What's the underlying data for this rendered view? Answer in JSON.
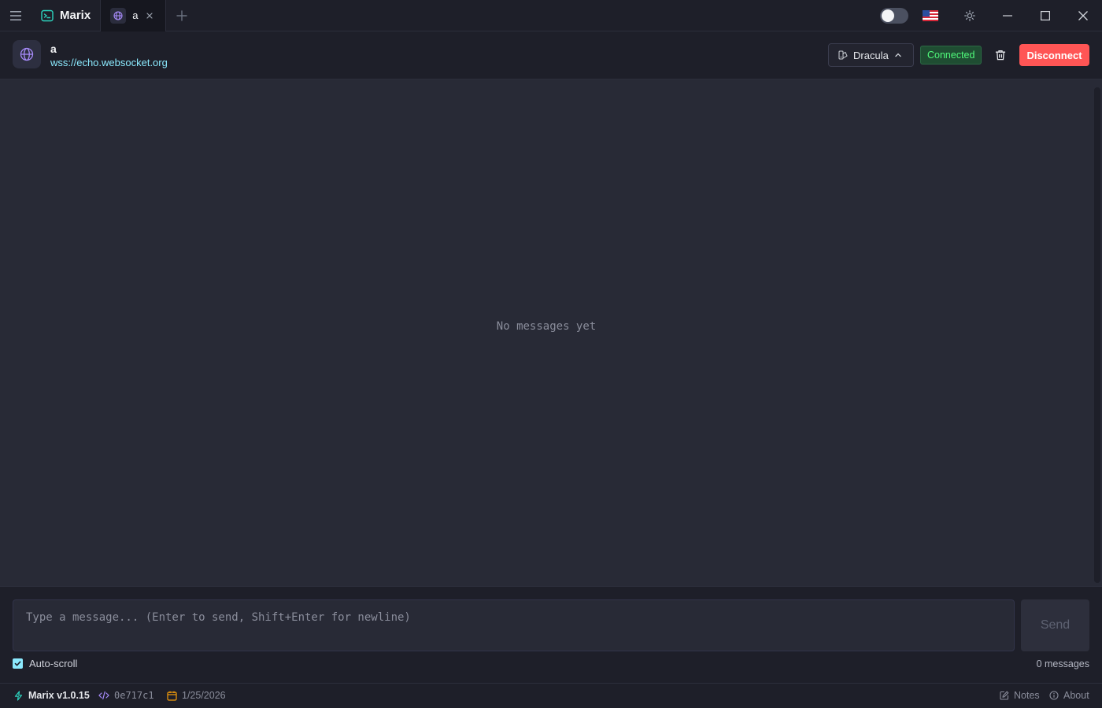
{
  "titlebar": {
    "app_name": "Marix",
    "tab_label": "a",
    "icons": [
      "menu-icon",
      "terminal-icon",
      "globe-icon",
      "close-icon",
      "plus-icon",
      "flag-us-icon",
      "sun-icon",
      "minimize-icon",
      "maximize-icon",
      "close-window-icon"
    ]
  },
  "connection": {
    "name": "a",
    "url": "wss://echo.websocket.org",
    "theme": "Dracula",
    "status": "Connected",
    "disconnect_label": "Disconnect"
  },
  "messages": {
    "empty_text": "No messages yet"
  },
  "composer": {
    "placeholder": "Type a message... (Enter to send, Shift+Enter for newline)",
    "send_label": "Send",
    "autoscroll_label": "Auto-scroll",
    "autoscroll_checked": true,
    "count_text": "0 messages"
  },
  "footer": {
    "version": "Marix v1.0.15",
    "commit": "0e717c1",
    "date": "1/25/2026",
    "notes_label": "Notes",
    "about_label": "About"
  },
  "colors": {
    "accent_cyan": "#8be9fd",
    "accent_purple": "#bd93f9",
    "status_green": "#50fa7b",
    "danger_red": "#ff5555",
    "bg": "#282a36",
    "bar_bg": "#1e1f29"
  }
}
